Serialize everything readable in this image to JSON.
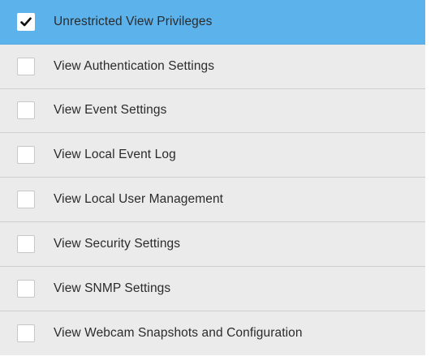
{
  "privileges": {
    "items": [
      {
        "label": "Unrestricted View Privileges",
        "checked": true
      },
      {
        "label": "View Authentication Settings",
        "checked": false
      },
      {
        "label": "View Event Settings",
        "checked": false
      },
      {
        "label": "View Local Event Log",
        "checked": false
      },
      {
        "label": "View Local User Management",
        "checked": false
      },
      {
        "label": "View Security Settings",
        "checked": false
      },
      {
        "label": "View SNMP Settings",
        "checked": false
      },
      {
        "label": "View Webcam Snapshots and Configuration",
        "checked": false
      }
    ]
  },
  "colors": {
    "selected_row": "#5cb3ec",
    "row_background": "#ebebeb",
    "checkmark": "#111111"
  }
}
